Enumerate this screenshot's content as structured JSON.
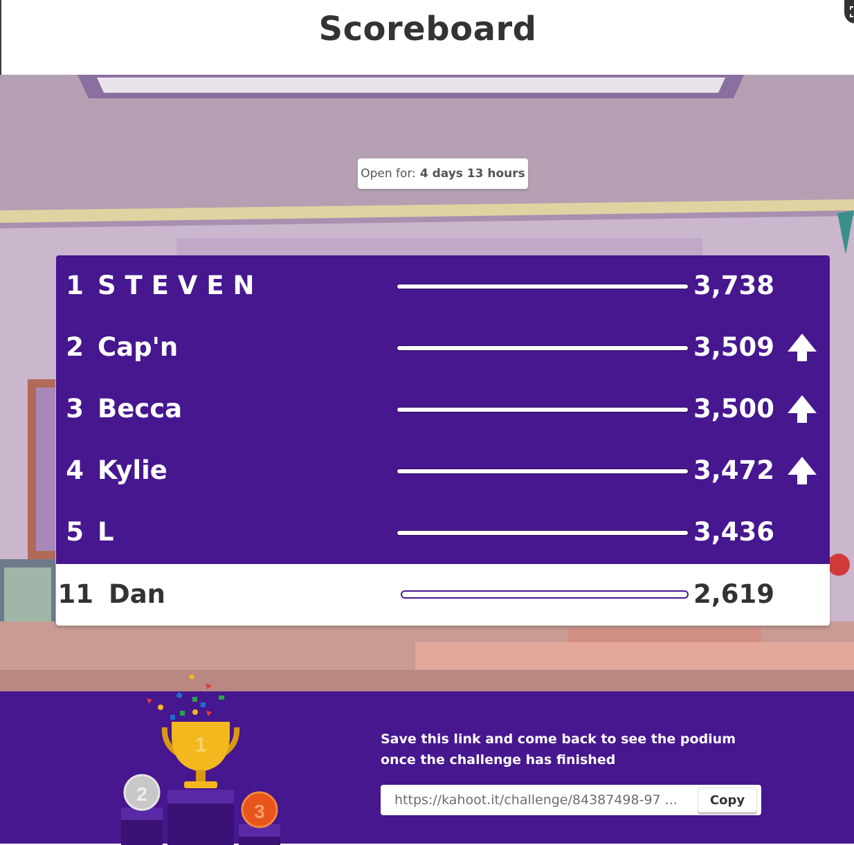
{
  "header": {
    "title": "Scoreboard"
  },
  "timer": {
    "label": "Open for:",
    "value": "4 days 13 hours"
  },
  "leaderboard": {
    "rows": [
      {
        "rank": "1",
        "name": "S T E V E N",
        "score": "3,738",
        "moved_up": false
      },
      {
        "rank": "2",
        "name": "Cap'n",
        "score": "3,509",
        "moved_up": true
      },
      {
        "rank": "3",
        "name": "Becca",
        "score": "3,500",
        "moved_up": true
      },
      {
        "rank": "4",
        "name": "Kylie",
        "score": "3,472",
        "moved_up": true
      },
      {
        "rank": "5",
        "name": "L",
        "score": "3,436",
        "moved_up": false
      }
    ],
    "current_player": {
      "rank": "11",
      "name": "Dan",
      "score": "2,619"
    }
  },
  "footer": {
    "save_message": "Save this link and come back to see the podium once the challenge has finished",
    "link_value": "https://kahoot.it/challenge/84387498-97 ...",
    "copy_label": "Copy",
    "podium_labels": {
      "first": "1",
      "second": "2",
      "third": "3"
    }
  },
  "colors": {
    "brand_purple": "#46178f",
    "background_scene": "#b6a1b3",
    "gold": "#f2b81d",
    "silver": "#c8c8c8",
    "bronze": "#e8541c"
  },
  "icons": {
    "arrow": "arrow-up-icon",
    "fullscreen": "fullscreen-icon",
    "trophy": "trophy-icon"
  }
}
